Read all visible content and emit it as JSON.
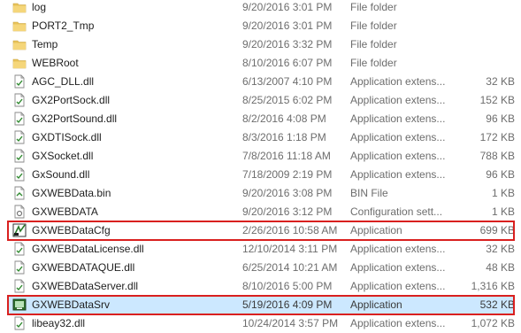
{
  "colors": {
    "highlight": "#d9201f",
    "selection": "#cce8ff",
    "folder": "#e8c35a",
    "muted_text": "#6d6d6d"
  },
  "rows": [
    {
      "name": "log",
      "date": "9/20/2016 3:01 PM",
      "type": "File folder",
      "size": "",
      "icon": "folder-icon"
    },
    {
      "name": "PORT2_Tmp",
      "date": "9/20/2016 3:01 PM",
      "type": "File folder",
      "size": "",
      "icon": "folder-icon"
    },
    {
      "name": "Temp",
      "date": "9/20/2016 3:32 PM",
      "type": "File folder",
      "size": "",
      "icon": "folder-icon"
    },
    {
      "name": "WEBRoot",
      "date": "8/10/2016 6:07 PM",
      "type": "File folder",
      "size": "",
      "icon": "folder-icon"
    },
    {
      "name": "AGC_DLL.dll",
      "date": "6/13/2007 4:10 PM",
      "type": "Application extens...",
      "size": "32 KB",
      "icon": "dll-file-icon"
    },
    {
      "name": "GX2PortSock.dll",
      "date": "8/25/2015 6:02 PM",
      "type": "Application extens...",
      "size": "152 KB",
      "icon": "dll-file-icon"
    },
    {
      "name": "GX2PortSound.dll",
      "date": "8/2/2016 4:08 PM",
      "type": "Application extens...",
      "size": "96 KB",
      "icon": "dll-file-icon"
    },
    {
      "name": "GXDTISock.dll",
      "date": "8/3/2016 1:18 PM",
      "type": "Application extens...",
      "size": "172 KB",
      "icon": "dll-file-icon"
    },
    {
      "name": "GXSocket.dll",
      "date": "7/8/2016 11:18 AM",
      "type": "Application extens...",
      "size": "788 KB",
      "icon": "dll-file-icon"
    },
    {
      "name": "GxSound.dll",
      "date": "7/18/2009 2:19 PM",
      "type": "Application extens...",
      "size": "96 KB",
      "icon": "dll-file-icon"
    },
    {
      "name": "GXWEBData.bin",
      "date": "9/20/2016 3:08 PM",
      "type": "BIN File",
      "size": "1 KB",
      "icon": "bin-file-icon"
    },
    {
      "name": "GXWEBDATA",
      "date": "9/20/2016 3:12 PM",
      "type": "Configuration sett...",
      "size": "1 KB",
      "icon": "config-file-icon"
    },
    {
      "name": "GXWEBDataCfg",
      "date": "2/26/2016 10:58 AM",
      "type": "Application",
      "size": "699 KB",
      "icon": "app-cfg-icon",
      "highlighted": true
    },
    {
      "name": "GXWEBDataLicense.dll",
      "date": "12/10/2014 3:11 PM",
      "type": "Application extens...",
      "size": "32 KB",
      "icon": "dll-file-icon"
    },
    {
      "name": "GXWEBDATAQUE.dll",
      "date": "6/25/2014 10:21 AM",
      "type": "Application extens...",
      "size": "48 KB",
      "icon": "dll-file-icon"
    },
    {
      "name": "GXWEBDataServer.dll",
      "date": "8/10/2016 5:00 PM",
      "type": "Application extens...",
      "size": "1,316 KB",
      "icon": "dll-file-icon"
    },
    {
      "name": "GXWEBDataSrv",
      "date": "5/19/2016 4:09 PM",
      "type": "Application",
      "size": "532 KB",
      "icon": "app-server-icon",
      "highlighted": true,
      "selected": true
    },
    {
      "name": "libeay32.dll",
      "date": "10/24/2014 3:57 PM",
      "type": "Application extens...",
      "size": "1,072 KB",
      "icon": "dll-file-icon"
    }
  ]
}
